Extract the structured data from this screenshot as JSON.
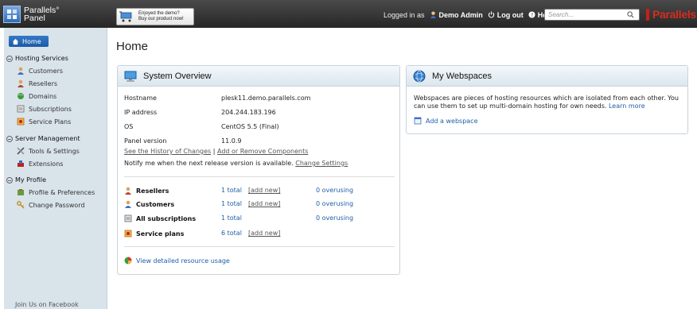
{
  "topbar": {
    "logo_line1": "Parallels°",
    "logo_line2": "Panel",
    "promo_line1": "Enjoyed the demo?",
    "promo_line2": "Buy our product now!",
    "logged_in_as": "Logged in as",
    "user_name": "Demo Admin",
    "logout_label": "Log out",
    "help_label": "Help",
    "search_placeholder": "Search...",
    "brand": "Parallels"
  },
  "sidebar": {
    "home_label": "Home",
    "sections": [
      {
        "title": "Hosting Services",
        "items": [
          "Customers",
          "Resellers",
          "Domains",
          "Subscriptions",
          "Service Plans"
        ]
      },
      {
        "title": "Server Management",
        "items": [
          "Tools & Settings",
          "Extensions"
        ]
      },
      {
        "title": "My Profile",
        "items": [
          "Profile & Preferences",
          "Change Password"
        ]
      }
    ],
    "footer": "Join Us on Facebook"
  },
  "main": {
    "page_title": "Home",
    "system_overview": {
      "title": "System Overview",
      "rows": [
        {
          "key": "Hostname",
          "value": "plesk11.demo.parallels.com"
        },
        {
          "key": "IP address",
          "value": "204.244.183.196"
        },
        {
          "key": "OS",
          "value": "CentOS 5.5 (Final)"
        },
        {
          "key": "Panel version",
          "value": "11.0.9"
        }
      ],
      "history_link": "See the History of Changes",
      "separator": "|",
      "components_link": "Add or Remove Components",
      "notify_text": "Notify me when the next release version is available.",
      "change_settings": "Change Settings",
      "stats": [
        {
          "label": "Resellers",
          "total": "1 total",
          "add": "[add new]",
          "overusing": "0 overusing"
        },
        {
          "label": "Customers",
          "total": "1 total",
          "add": "[add new]",
          "overusing": "0 overusing"
        },
        {
          "label": "All subscriptions",
          "total": "1 total",
          "add": "",
          "overusing": "0 overusing"
        },
        {
          "label": "Service plans",
          "total": "6 total",
          "add": "[add new]",
          "overusing": ""
        }
      ],
      "resource_link": "View detailed resource usage"
    },
    "webspaces": {
      "title": "My Webspaces",
      "description": "Webspaces are pieces of hosting resources which are isolated from each other. You can use them to set up multi-domain hosting for own needs.",
      "learn_more": "Learn more",
      "add_label": "Add a webspace"
    }
  }
}
